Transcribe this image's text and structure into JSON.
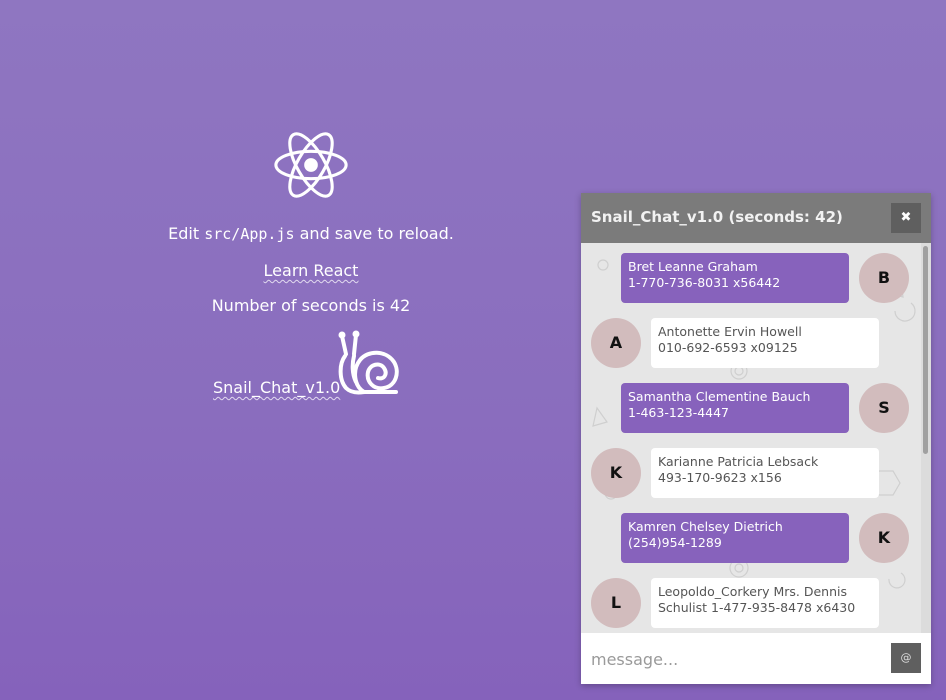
{
  "app": {
    "logo_icon": "react-atom-icon",
    "edit_prefix": "Edit ",
    "edit_code": "src/App.js",
    "edit_suffix": " and save to reload.",
    "learn_link": "Learn React",
    "seconds_text": "Number of seconds is 42",
    "snail_link": "Snail_Chat_v1.0",
    "snail_icon": "snail-icon"
  },
  "chat": {
    "title": "Snail_Chat_v1.0 (seconds: 42)",
    "close_label": "✖",
    "close_icon": "close-icon",
    "messages": [
      {
        "direction": "out",
        "avatar": "B",
        "line1": "Bret Leanne Graham",
        "line2": "1-770-736-8031 x56442"
      },
      {
        "direction": "in",
        "avatar": "A",
        "line1": "Antonette Ervin Howell",
        "line2": "010-692-6593 x09125"
      },
      {
        "direction": "out",
        "avatar": "S",
        "line1": "Samantha Clementine Bauch",
        "line2": "1-463-123-4447"
      },
      {
        "direction": "in",
        "avatar": "K",
        "line1": "Karianne Patricia Lebsack",
        "line2": "493-170-9623 x156"
      },
      {
        "direction": "out",
        "avatar": "K",
        "line1": "Kamren Chelsey Dietrich",
        "line2": "(254)954-1289"
      },
      {
        "direction": "in",
        "avatar": "L",
        "line1": "Leopoldo_Corkery Mrs. Dennis",
        "line2": "Schulist 1-477-935-8478 x6430"
      }
    ],
    "input_placeholder": "message...",
    "send_label": "@",
    "colors": {
      "header": "#7b7b7b",
      "outgoing_bubble": "#8762bc",
      "incoming_bubble": "#ffffff",
      "avatar": "#d2bcbd",
      "body": "#e6e6e6"
    }
  }
}
